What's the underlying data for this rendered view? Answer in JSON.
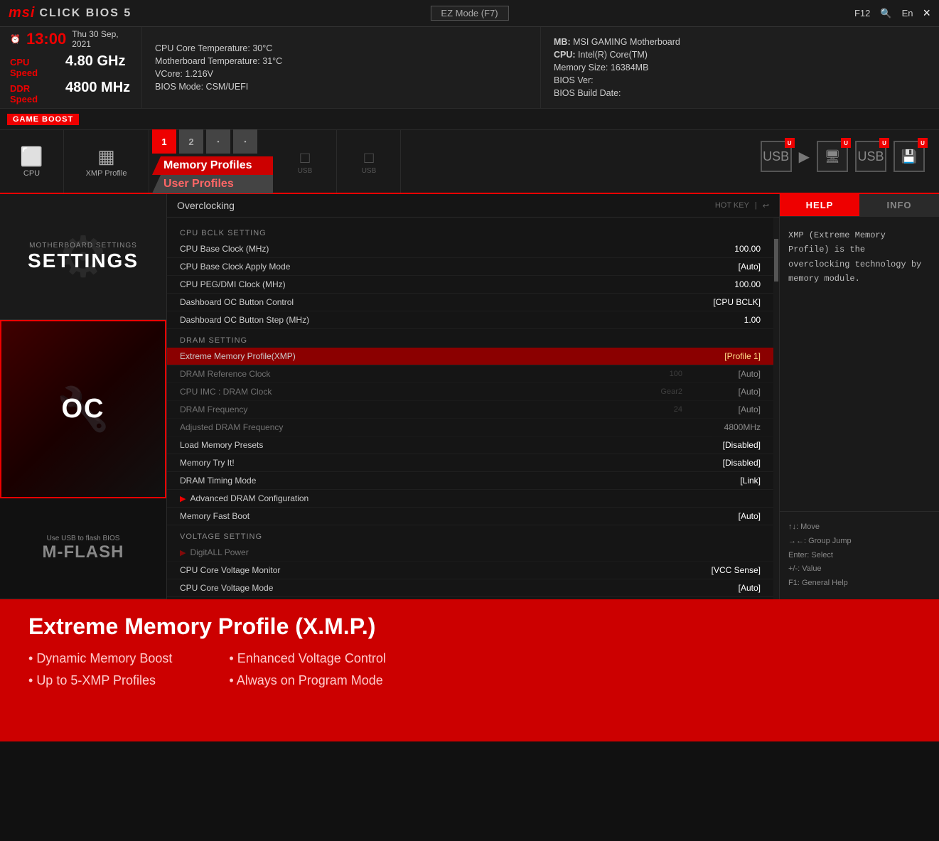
{
  "topbar": {
    "logo": "msi",
    "title": "CLICK BIOS 5",
    "ez_mode": "EZ Mode (F7)",
    "f12": "F12",
    "lang": "En",
    "close": "×"
  },
  "infobar": {
    "clock_icon": "⏰",
    "time": "13:00",
    "date": "Thu 30 Sep, 2021",
    "cpu_speed_label": "CPU Speed",
    "cpu_speed_val": "4.80 GHz",
    "ddr_speed_label": "DDR Speed",
    "ddr_speed_val": "4800 MHz",
    "cpu_temp": "CPU Core Temperature: 30°C",
    "mb_temp": "Motherboard Temperature: 31°C",
    "vcore": "VCore: 1.216V",
    "bios_mode": "BIOS Mode: CSM/UEFI",
    "mb_label": "MB:",
    "mb_val": "MSI GAMING Motherboard",
    "cpu_label": "CPU:",
    "cpu_val": "Intel(R) Core(TM)",
    "mem_label": "Memory Size:",
    "mem_val": "16384MB",
    "bios_ver_label": "BIOS Ver:",
    "bios_ver_val": "",
    "bios_build_label": "BIOS Build Date:",
    "bios_build_val": ""
  },
  "gameboost": {
    "label": "GAME BOOST"
  },
  "nav": {
    "cpu_label": "CPU",
    "xmp_label": "XMP Profile",
    "xmp_btn1": "1",
    "xmp_btn2": "2",
    "memory_profiles": "Memory Profiles",
    "user_profiles": "User Profiles",
    "usb_label": "USB",
    "mflash_label": "M-FLASH"
  },
  "sidebar": {
    "settings_sub": "Motherboard settings",
    "settings_title": "SETTINGS",
    "oc_title": "OC",
    "mflash_sub": "Use USB to flash BIOS",
    "mflash_title": "M-FLASH"
  },
  "panel": {
    "title": "Overclocking",
    "hotkey": "HOT KEY",
    "sections": [
      {
        "id": "cpu_bclk",
        "header": "CPU BCLK Setting",
        "items": [
          {
            "name": "CPU Base Clock (MHz)",
            "sub": "",
            "val": "100.00",
            "highlighted": false,
            "dimmed": false,
            "arrow": false
          },
          {
            "name": "CPU Base Clock Apply Mode",
            "sub": "",
            "val": "[Auto]",
            "highlighted": false,
            "dimmed": false,
            "arrow": false
          },
          {
            "name": "CPU PEG/DMI Clock (MHz)",
            "sub": "",
            "val": "100.00",
            "highlighted": false,
            "dimmed": false,
            "arrow": false
          },
          {
            "name": "Dashboard OC Button Control",
            "sub": "",
            "val": "[CPU BCLK]",
            "highlighted": false,
            "dimmed": false,
            "arrow": false
          },
          {
            "name": "Dashboard OC Button Step (MHz)",
            "sub": "",
            "val": "1.00",
            "highlighted": false,
            "dimmed": false,
            "arrow": false
          }
        ]
      },
      {
        "id": "dram",
        "header": "DRAM Setting",
        "items": [
          {
            "name": "Extreme Memory Profile(XMP)",
            "sub": "",
            "val": "[Profile 1]",
            "highlighted": true,
            "dimmed": false,
            "arrow": false
          },
          {
            "name": "DRAM Reference Clock",
            "sub": "100",
            "val": "[Auto]",
            "highlighted": false,
            "dimmed": true,
            "arrow": false
          },
          {
            "name": "CPU IMC : DRAM Clock",
            "sub": "Gear2",
            "val": "[Auto]",
            "highlighted": false,
            "dimmed": true,
            "arrow": false
          },
          {
            "name": "DRAM Frequency",
            "sub": "24",
            "val": "[Auto]",
            "highlighted": false,
            "dimmed": true,
            "arrow": false
          },
          {
            "name": "Adjusted DRAM Frequency",
            "sub": "",
            "val": "4800MHz",
            "highlighted": false,
            "dimmed": true,
            "arrow": false
          },
          {
            "name": "Load Memory Presets",
            "sub": "",
            "val": "[Disabled]",
            "highlighted": false,
            "dimmed": false,
            "arrow": false
          },
          {
            "name": "Memory Try It!",
            "sub": "",
            "val": "[Disabled]",
            "highlighted": false,
            "dimmed": false,
            "arrow": false
          },
          {
            "name": "DRAM Timing Mode",
            "sub": "",
            "val": "[Link]",
            "highlighted": false,
            "dimmed": false,
            "arrow": false
          },
          {
            "name": "Advanced DRAM Configuration",
            "sub": "",
            "val": "",
            "highlighted": false,
            "dimmed": false,
            "arrow": true
          },
          {
            "name": "Memory Fast Boot",
            "sub": "",
            "val": "[Auto]",
            "highlighted": false,
            "dimmed": false,
            "arrow": false
          }
        ]
      },
      {
        "id": "voltage",
        "header": "Voltage Setting",
        "items": [
          {
            "name": "DigitALL Power",
            "sub": "",
            "val": "",
            "highlighted": false,
            "dimmed": true,
            "arrow": true
          },
          {
            "name": "CPU Core Voltage Monitor",
            "sub": "",
            "val": "[VCC Sense]",
            "highlighted": false,
            "dimmed": false,
            "arrow": false
          },
          {
            "name": "CPU Core Voltage Mode",
            "sub": "",
            "val": "[Auto]",
            "highlighted": false,
            "dimmed": false,
            "arrow": false
          }
        ]
      }
    ]
  },
  "help": {
    "tab_help": "HELP",
    "tab_info": "INFO",
    "content": "XMP (Extreme Memory Profile) is the overclocking technology by memory module.",
    "footer": [
      "↑↓: Move",
      "→←: Group Jump",
      "Enter: Select",
      "+/-: Value",
      "F1: General Help"
    ]
  },
  "banner": {
    "title": "Extreme Memory Profile (X.M.P.)",
    "features_left": [
      "Dynamic Memory Boost",
      "Up to 5-XMP Profiles"
    ],
    "features_right": [
      "Enhanced Voltage Control",
      "Always on Program Mode"
    ]
  }
}
